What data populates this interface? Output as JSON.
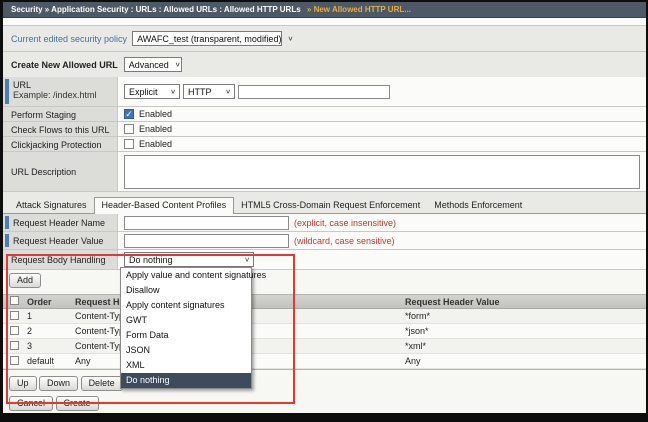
{
  "breadcrumb": {
    "path": "Security  »  Application Security : URLs : Allowed URLs : Allowed HTTP URLs",
    "current": "»  New Allowed HTTP URL...",
    "bar_color": "#4d5966",
    "current_color": "#e3af3c"
  },
  "policy": {
    "label": "Current edited security policy",
    "value": "AWAFC_test (transparent, modified)"
  },
  "header": {
    "title": "Create New Allowed URL",
    "mode_value": "Advanced"
  },
  "form": {
    "url_row": {
      "label": "URL",
      "example": "Example: /index.html",
      "match_value": "Explicit",
      "scheme_value": "HTTP",
      "url_value": "",
      "url_placeholder": ""
    },
    "perform_staging": {
      "label": "Perform Staging",
      "checkbox_label": "Enabled",
      "checked": true
    },
    "check_flows": {
      "label": "Check Flows to this URL",
      "checkbox_label": "Enabled",
      "checked": false
    },
    "clickjacking": {
      "label": "Clickjacking Protection",
      "checkbox_label": "Enabled",
      "checked": false
    },
    "description": {
      "label": "URL Description",
      "value": ""
    }
  },
  "tabs": [
    {
      "label": "Attack Signatures",
      "active": false
    },
    {
      "label": "Header-Based Content Profiles",
      "active": true
    },
    {
      "label": "HTML5 Cross-Domain Request Enforcement",
      "active": false
    },
    {
      "label": "Methods Enforcement",
      "active": false
    }
  ],
  "profile_form": {
    "header_name": {
      "label": "Request Header Name",
      "value": "",
      "hint": "(explicit, case insensitive)"
    },
    "header_value": {
      "label": "Request Header Value",
      "value": "",
      "hint": "(wildcard, case sensitive)"
    },
    "body_handling": {
      "label": "Request Body Handling",
      "value": "Do nothing"
    }
  },
  "dropdown": {
    "selected": "Do nothing",
    "options": [
      "Apply value and content signatures",
      "Disallow",
      "Apply content signatures",
      "GWT",
      "Form Data",
      "JSON",
      "XML",
      "Do nothing"
    ]
  },
  "table": {
    "columns": [
      "Order",
      "Request Header Name",
      "Request Header Value"
    ],
    "rows": [
      {
        "order": "1",
        "name": "Content-Type",
        "value": "*form*"
      },
      {
        "order": "2",
        "name": "Content-Type",
        "value": "*json*"
      },
      {
        "order": "3",
        "name": "Content-Type",
        "value": "*xml*"
      },
      {
        "order": "default",
        "name": "Any",
        "value": "Any"
      }
    ]
  },
  "buttons": {
    "add": "Add",
    "up": "Up",
    "down": "Down",
    "delete": "Delete",
    "cancel": "Cancel",
    "create": "Create"
  },
  "annotation_color": "#e23b2e"
}
